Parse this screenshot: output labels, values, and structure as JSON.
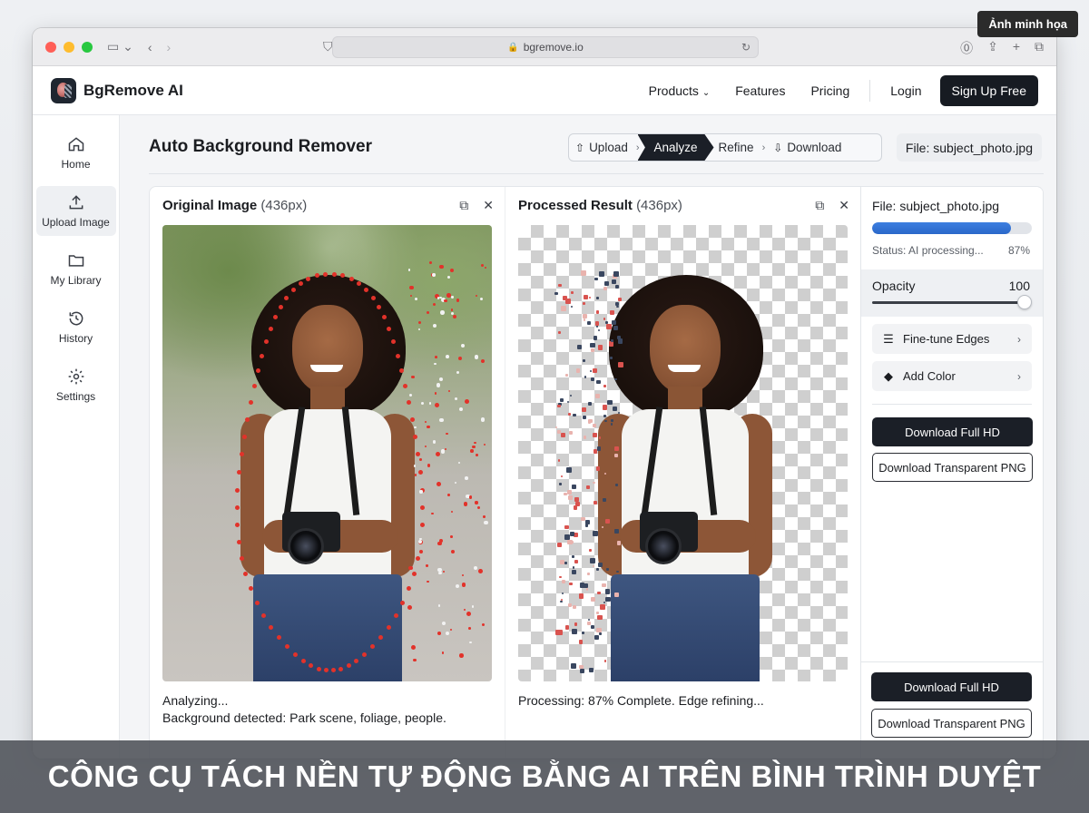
{
  "overlay_badge": "Ảnh minh họa",
  "browser": {
    "url": "bgremove.io"
  },
  "nav": {
    "brand": "BgRemove AI",
    "links": [
      "Products",
      "Features",
      "Pricing"
    ],
    "login": "Login",
    "signup": "Sign Up Free"
  },
  "sidebar": {
    "items": [
      {
        "label": "Home",
        "icon": "home-icon"
      },
      {
        "label": "Upload Image",
        "icon": "upload-icon",
        "active": true
      },
      {
        "label": "My Library",
        "icon": "folder-icon"
      },
      {
        "label": "History",
        "icon": "history-icon"
      },
      {
        "label": "Settings",
        "icon": "gear-icon"
      }
    ]
  },
  "main": {
    "title": "Auto Background Remover",
    "steps": [
      "Upload",
      "Analyze",
      "Refine",
      "Download"
    ],
    "active_step": "Analyze",
    "file_chip": "File: subject_photo.jpg"
  },
  "original": {
    "title": "Original Image",
    "size": "(436px)",
    "caption_line1": "Analyzing...",
    "caption_line2": "Background detected: Park scene, foliage, people."
  },
  "processed": {
    "title": "Processed Result",
    "size": "(436px)",
    "caption": "Processing: 87% Complete. Edge refining..."
  },
  "right_panel": {
    "file": "File: subject_photo.jpg",
    "progress": 0.87,
    "status": "Status: AI processing...",
    "percent": "87%",
    "opacity_label": "Opacity",
    "opacity_value": "100",
    "fine_tune": "Fine-tune Edges",
    "add_color": "Add Color",
    "download_hd": "Download Full HD",
    "download_png": "Download Transparent PNG",
    "download_hd_2": "Download Full HD",
    "download_png_2": "Download Transparent PNG"
  },
  "banner": "CÔNG CỤ TÁCH NỀN TỰ ĐỘNG BẰNG AI TRÊN BÌNH TRÌNH DUYỆT",
  "colors": {
    "accent": "#2a67c9",
    "dark": "#1b1f27",
    "dot_red": "#e2322a"
  }
}
